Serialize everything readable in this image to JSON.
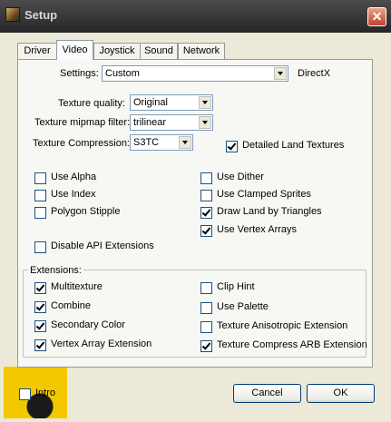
{
  "window": {
    "title": "Setup",
    "close_glyph": "✕"
  },
  "tabs": [
    {
      "label": "Driver",
      "active": false
    },
    {
      "label": "Video",
      "active": true
    },
    {
      "label": "Joystick",
      "active": false
    },
    {
      "label": "Sound",
      "active": false
    },
    {
      "label": "Network",
      "active": false
    }
  ],
  "settings": {
    "label": "Settings:",
    "value": "Custom",
    "api_label": "DirectX"
  },
  "texture": {
    "quality_label": "Texture quality:",
    "quality_value": "Original",
    "mipmap_label": "Texture mipmap filter:",
    "mipmap_value": "trilinear",
    "compression_label": "Texture Compression:",
    "compression_value": "S3TC"
  },
  "detailed_land": {
    "label": "Detailed Land Textures",
    "checked": true
  },
  "options_left": [
    {
      "label": "Use Alpha",
      "checked": false
    },
    {
      "label": "Use Index",
      "checked": false
    },
    {
      "label": "Polygon Stipple",
      "checked": false
    }
  ],
  "options_right": [
    {
      "label": "Use Dither",
      "checked": false
    },
    {
      "label": "Use Clamped Sprites",
      "checked": false
    },
    {
      "label": "Draw Land by Triangles",
      "checked": true
    },
    {
      "label": "Use Vertex Arrays",
      "checked": true
    }
  ],
  "disable_api": {
    "label": "Disable API Extensions",
    "checked": false
  },
  "extensions": {
    "group_label": "Extensions:",
    "left": [
      {
        "label": "Multitexture",
        "checked": true
      },
      {
        "label": "Combine",
        "checked": true
      },
      {
        "label": "Secondary Color",
        "checked": true
      },
      {
        "label": "Vertex Array Extension",
        "checked": true
      }
    ],
    "right": [
      {
        "label": "Clip Hint",
        "checked": false
      },
      {
        "label": "Use Palette",
        "checked": false
      },
      {
        "label": "Texture Anisotropic Extension",
        "checked": false
      },
      {
        "label": "Texture Compress ARB Extension",
        "checked": true
      }
    ]
  },
  "intro": {
    "label": "Intro",
    "checked": false
  },
  "buttons": {
    "cancel": "Cancel",
    "ok": "OK"
  }
}
